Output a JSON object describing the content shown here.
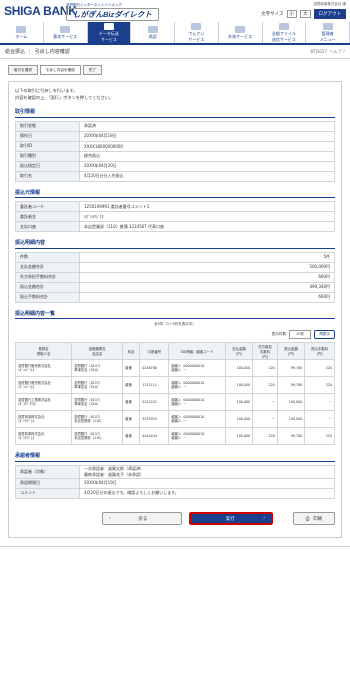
{
  "header": {
    "bank": "SHIGA BANK",
    "service_small": "滋賀銀行インターネットバンキング",
    "service": "しがぎんBizダイレクト",
    "user": "滋賀商事株式会社 様",
    "char_size": "文字サイズ",
    "logout": "ログアウト"
  },
  "nav": [
    {
      "label": "ホーム"
    },
    {
      "label": "基本サービス"
    },
    {
      "label": "データ伝送\nサービス"
    },
    {
      "label": "承認"
    },
    {
      "label": "でんさい\nサービス"
    },
    {
      "label": "外為サービス"
    },
    {
      "label": "全銀ファイル\n送信サービス"
    },
    {
      "label": "管理者\nメニュー"
    }
  ],
  "title": {
    "main": "総合振込",
    "sub": "引戻し内容確認",
    "code": "BTJS027",
    "help": "ヘルプ"
  },
  "steps": [
    "取引を選択",
    "引戻し内容を確認",
    "完了"
  ],
  "intro": [
    "以下の取引に引戻しを行います。",
    "内容を確認の上、「実行」ボタンを押してください。"
  ],
  "s1": {
    "title": "取引情報",
    "rows": [
      [
        "取引状態",
        "承認済"
      ],
      [
        "操作日",
        "20XX年04月18日"
      ],
      [
        "取引ID",
        "XXXX18000000000"
      ],
      [
        "取引種別",
        "総合振込"
      ],
      [
        "振込指定日",
        "20XX年04月20日"
      ],
      [
        "取引名",
        "4月20日分仕入先振込"
      ]
    ]
  },
  "s2": {
    "title": "振込元情報",
    "rows": [
      [
        "委託者コード",
        "1250109991 委託者番号コメント1"
      ],
      [
        "委託者名",
        "ｼｶﾞｼﾖｳｼﾞ(ｶ"
      ],
      [
        "支払口座",
        "本店営業部（110）普通 1234567 代表口座"
      ]
    ]
  },
  "s3": {
    "title": "振込明細内容",
    "rows": [
      [
        "件数",
        "5件"
      ],
      [
        "支払金額合計",
        "500,000円"
      ],
      [
        "先方負担手数料合計",
        "660円"
      ],
      [
        "振込金額合計",
        "499,340円"
      ],
      [
        "振込手数料合計",
        "660円"
      ]
    ]
  },
  "s4": {
    "title": "振込明細内容一覧",
    "pager": "全5件（1〜5件を表示中）",
    "show_label": "表示件数",
    "show_val": "10件",
    "refresh": "再表示",
    "headers": [
      "登録名\n受取人名",
      "金融機関名\n支店名",
      "科目",
      "口座番号",
      "EDI情報／顧客コード",
      "支払金額\n(円)",
      "先方負担\n手数料\n(円)",
      "振込金額\n(円)",
      "振込手数料\n(円)"
    ],
    "rows": [
      [
        "滋賀銀行販売株式会社\nｼｶﾞﾊﾝﾊﾞｲ(ｶ",
        "滋賀銀行（0157）\n草津支店（510）",
        "普通",
        "0246780",
        "顧客1：0000000010\n顧客2：－",
        "100,000",
        "220",
        "99,780",
        "220"
      ],
      [
        "滋賀銀行販売株式会社\nｼｶﾞﾊﾝﾊﾞｲ(ｶ",
        "滋賀銀行（0157）\n草津支店（510）",
        "普通",
        "1111111",
        "顧客1：0000000010\n顧客2：－",
        "100,000",
        "220",
        "99,780",
        "220"
      ],
      [
        "滋賀銀行工業株式会社\nｼｶﾞｺｳｷﾞﾖｳ(ｶ",
        "滋賀銀行（0157）\n草津支店（510）",
        "普通",
        "2222222",
        "顧客1：0000000010\n顧客2：－",
        "100,000",
        "－",
        "100,000",
        "－"
      ],
      [
        "滋賀商事株式会社\nｼｶﾞｼﾖｳｼﾞ(ｶ",
        "滋賀銀行（0157）\n本店営業部（110）",
        "普通",
        "3333333",
        "顧客1：0000000010\n顧客2：－",
        "100,000",
        "－",
        "100,000",
        "－"
      ],
      [
        "滋賀商事株式会社\nｼｶﾞｼﾖｳｼﾞ(ｶ",
        "滋賀銀行（0157）\n本店営業部（110）",
        "普通",
        "4444444",
        "顧客1：0000000010\n顧客2：－",
        "100,000",
        "220",
        "99,780",
        "220"
      ]
    ]
  },
  "s5": {
    "title": "承認者情報",
    "rows": [
      [
        "承認者（対象）",
        "一次承認者：滋賀太郎（承認済）\n最終承認者：滋賀花子（未承認）"
      ],
      [
        "承認期限日",
        "20XX年04月19日"
      ],
      [
        "コメント",
        "4月20日分の振込です。確認よろしくお願いします。"
      ]
    ]
  },
  "buttons": {
    "back": "戻る",
    "exec": "実行",
    "print": "印刷"
  }
}
